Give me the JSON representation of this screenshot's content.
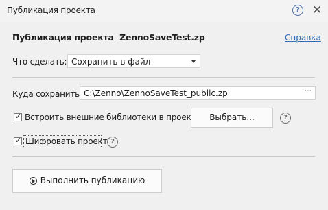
{
  "window": {
    "title": "Публикация проекта",
    "help_icon": "question-circle-icon",
    "close_icon": "close-icon"
  },
  "header": {
    "text": "Публикация проекта  ZennoSaveTest.zp",
    "help_link": "Справка"
  },
  "action": {
    "label": "Что сделать:",
    "selected": "Сохранить в файл"
  },
  "save": {
    "label": "Куда сохранить:",
    "path": "C:\\Zenno\\ZennoSaveTest_public.zp",
    "browse": "···"
  },
  "embed": {
    "checked": true,
    "label": "Встроить внешние библиотеки в проект",
    "choose_button": "Выбрать..."
  },
  "encrypt": {
    "checked": true,
    "label": "Шифровать проект"
  },
  "publish_button": "Выполнить публикацию"
}
